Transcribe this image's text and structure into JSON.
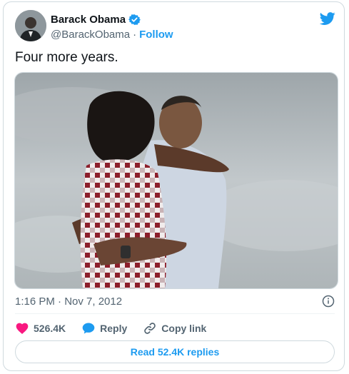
{
  "author": {
    "name": "Barack Obama",
    "handle": "@BarackObama",
    "separator": "·",
    "follow_label": "Follow",
    "verified": true
  },
  "tweet": {
    "text": "Four more years.",
    "timestamp": "1:16 PM · Nov 7, 2012"
  },
  "actions": {
    "likes_count": "526.4K",
    "reply_label": "Reply",
    "copy_link_label": "Copy link"
  },
  "replies_button_label": "Read 52.4K replies",
  "icons": {
    "verified": "verified-badge-icon",
    "bird": "twitter-bird-icon",
    "info": "info-icon",
    "like": "heart-icon",
    "reply": "speech-bubble-icon",
    "copy_link": "link-icon"
  },
  "colors": {
    "accent": "#1d9bf0",
    "like": "#f91880",
    "text_primary": "#0f1419",
    "text_secondary": "#536471",
    "border": "#cfd9de"
  }
}
